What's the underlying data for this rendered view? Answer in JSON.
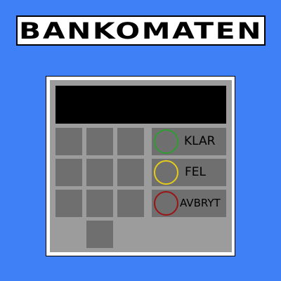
{
  "title": "BANKOMATEN",
  "actions": {
    "ok": {
      "label": "KLAR",
      "ring_color": "#2e9e32"
    },
    "error": {
      "label": "FEL",
      "ring_color": "#e6cc1a"
    },
    "cancel": {
      "label": "AVBRYT",
      "ring_color": "#9a1414"
    }
  },
  "colors": {
    "background": "#3f80f6",
    "panel": "#9c9c9c",
    "key": "#6f6f6f",
    "screen": "#000000"
  }
}
